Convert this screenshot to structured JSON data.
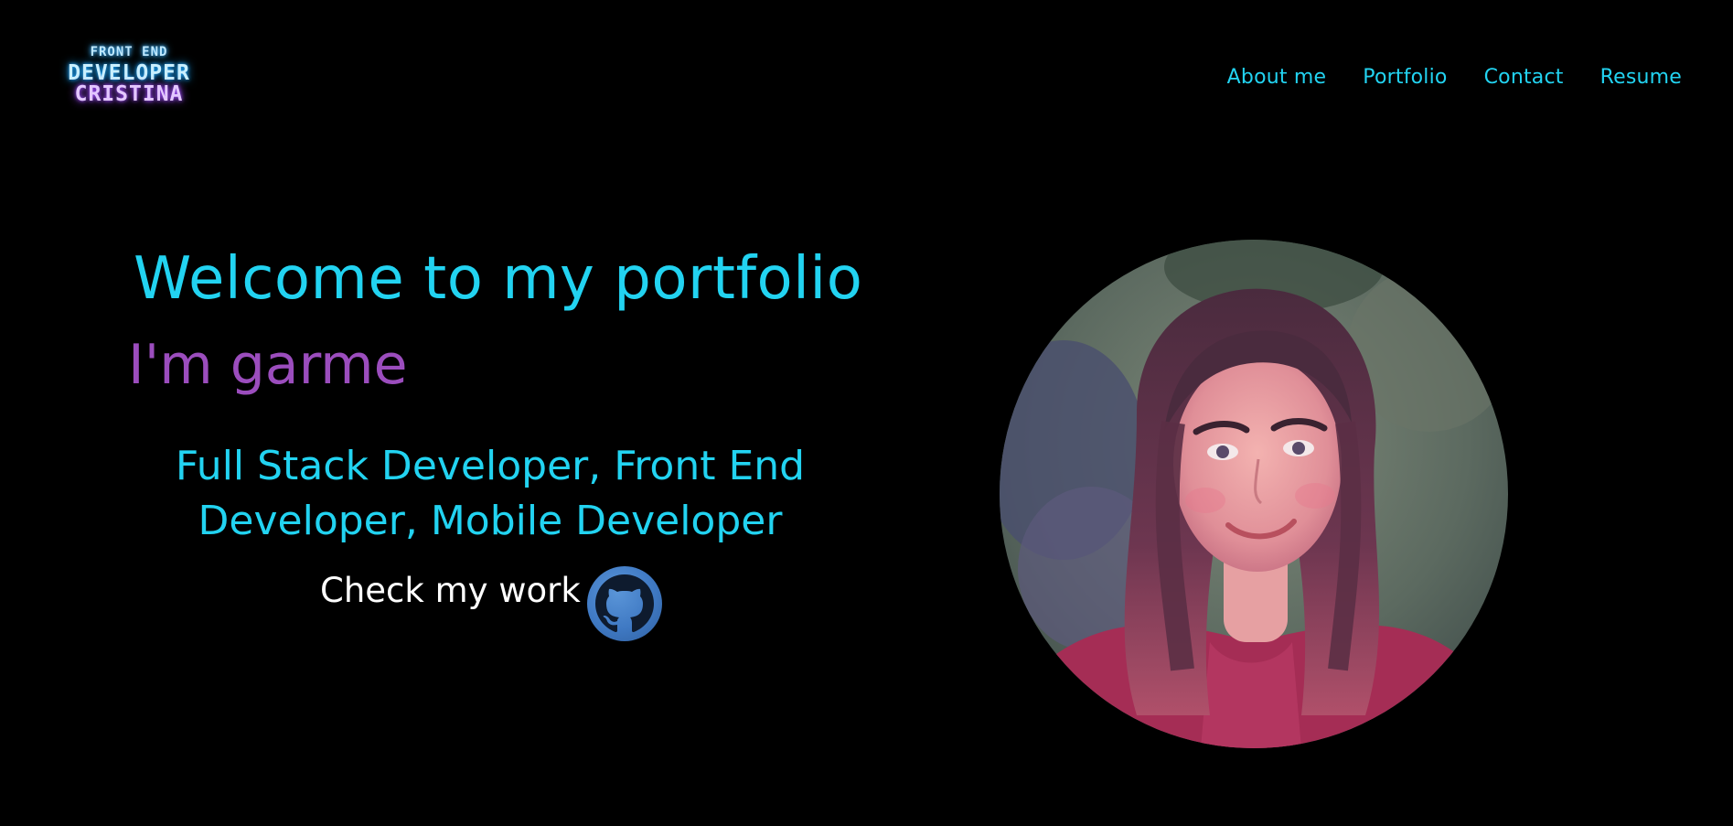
{
  "logo": {
    "line1": "FRONT END",
    "line2": "DEVELOPER",
    "line3": "CRISTINA"
  },
  "nav": {
    "items": [
      {
        "label": "About me"
      },
      {
        "label": "Portfolio"
      },
      {
        "label": "Contact"
      },
      {
        "label": "Resume"
      }
    ]
  },
  "hero": {
    "welcome": "Welcome to my portfolio",
    "intro": "I'm garme",
    "roles": "Full Stack Developer, Front End Developer, Mobile Developer",
    "cta": "Check my work",
    "cta_icon": "github-icon"
  },
  "colors": {
    "background": "#000000",
    "accent": "#22d3f1",
    "name": "#9b4dbd",
    "github_button": "#3f79c3"
  }
}
